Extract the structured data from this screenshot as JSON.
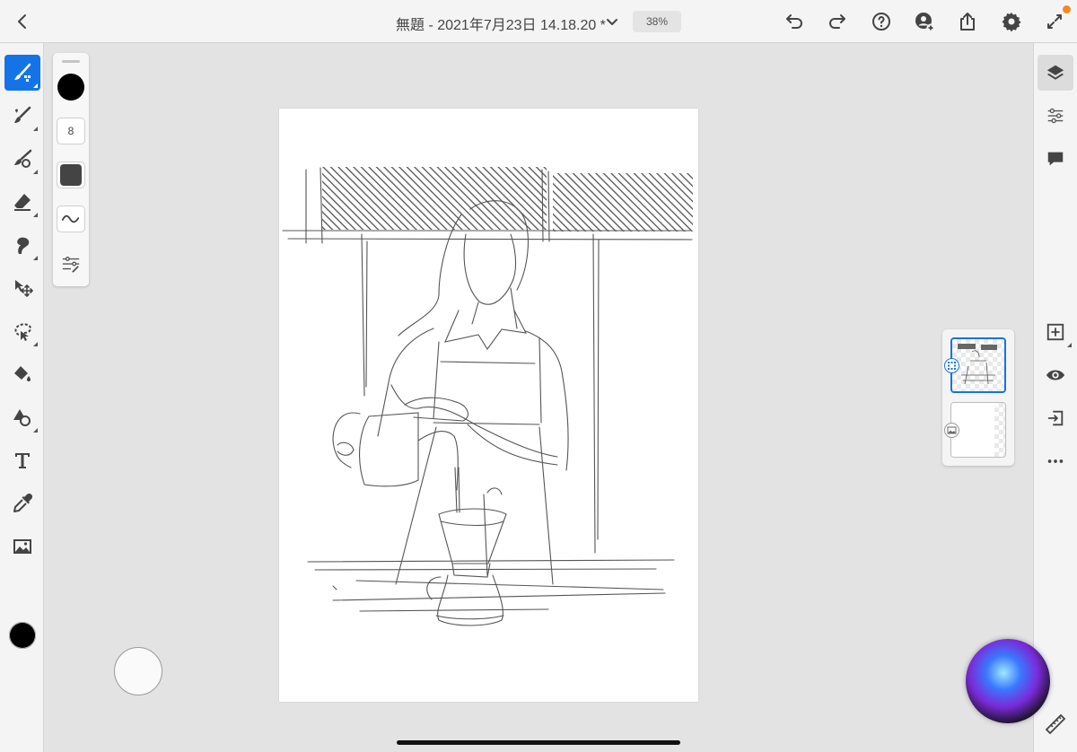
{
  "app": {
    "document_title": "無題 - 2021年7月23日 14.18.20 *",
    "zoom_level": "38%"
  },
  "topbar": {
    "back": {
      "icon": "chevron-left-icon"
    },
    "title_menu": {
      "icon": "chevron-down-icon"
    },
    "actions": [
      {
        "name": "undo",
        "icon": "undo-icon"
      },
      {
        "name": "redo",
        "icon": "redo-icon"
      },
      {
        "name": "help",
        "icon": "help-icon"
      },
      {
        "name": "invite",
        "icon": "add-person-icon"
      },
      {
        "name": "share",
        "icon": "share-icon"
      },
      {
        "name": "settings",
        "icon": "gear-icon"
      },
      {
        "name": "fullscreen",
        "icon": "expand-icon"
      }
    ],
    "notification_color": "#f08b1d"
  },
  "toolbar": {
    "tools": [
      {
        "name": "pixel-brush",
        "icon": "pixel-brush-icon",
        "active": true
      },
      {
        "name": "live-brush",
        "icon": "live-brush-icon"
      },
      {
        "name": "vector-brush",
        "icon": "vector-brush-icon"
      },
      {
        "name": "eraser",
        "icon": "eraser-icon"
      },
      {
        "name": "smudge",
        "icon": "smudge-icon"
      },
      {
        "name": "transform",
        "icon": "move-icon"
      },
      {
        "name": "lasso",
        "icon": "lasso-icon"
      },
      {
        "name": "fill",
        "icon": "paint-bucket-icon"
      },
      {
        "name": "shapes",
        "icon": "shapes-icon"
      },
      {
        "name": "text",
        "icon": "text-icon"
      },
      {
        "name": "eyedropper",
        "icon": "eyedropper-icon"
      },
      {
        "name": "image",
        "icon": "image-icon"
      }
    ],
    "active_color": "#000000",
    "accent_color": "#1473e6"
  },
  "brush_panel": {
    "color": "#000000",
    "size": "8",
    "opacity_color": "#444444",
    "brush_icon": "brush-stroke-icon",
    "settings_icon": "brush-settings-icon"
  },
  "right_rail": {
    "top": [
      {
        "name": "layers",
        "icon": "layers-icon",
        "active": true
      },
      {
        "name": "properties",
        "icon": "sliders-icon"
      },
      {
        "name": "comments",
        "icon": "comment-icon"
      }
    ],
    "layer_actions": [
      {
        "name": "add-layer",
        "icon": "add-layer-icon"
      },
      {
        "name": "visibility",
        "icon": "eye-icon"
      },
      {
        "name": "import",
        "icon": "import-icon"
      },
      {
        "name": "more",
        "icon": "more-icon"
      }
    ]
  },
  "layers": [
    {
      "name": "sketch-layer",
      "selected": true,
      "badge_icon": "pixel-layer-icon"
    },
    {
      "name": "background-layer",
      "selected": false,
      "badge_icon": "image-layer-icon"
    }
  ]
}
